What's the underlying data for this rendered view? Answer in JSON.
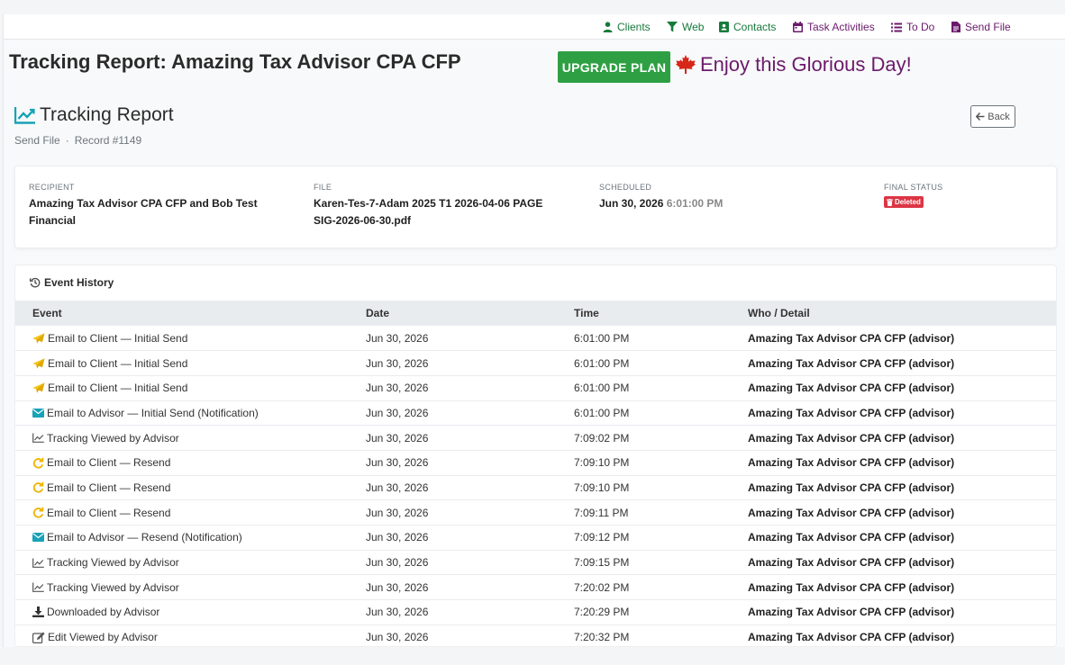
{
  "nav": {
    "items": [
      {
        "label": "Clients",
        "icon": "user-icon"
      },
      {
        "label": "Web",
        "icon": "filter-icon"
      },
      {
        "label": "Contacts",
        "icon": "address-book-icon"
      },
      {
        "label": "Task Activities",
        "icon": "calendar-icon"
      },
      {
        "label": "To Do",
        "icon": "list-icon"
      },
      {
        "label": "Send File",
        "icon": "file-icon"
      }
    ]
  },
  "header": {
    "title": "Tracking Report: Amazing Tax Advisor CPA CFP",
    "upgrade_label": "UPGRADE PLAN",
    "tagline": "Enjoy this Glorious Day!"
  },
  "report": {
    "title": "Tracking Report",
    "crumb_section": "Send File",
    "crumb_separator": "·",
    "crumb_record": "Record #1149",
    "back_label": "Back"
  },
  "summary": {
    "recipient_label": "Recipient",
    "recipient_line1": "Amazing Tax Advisor CPA CFP and Bob Test",
    "recipient_line2": "Financial",
    "file_label": "File",
    "file_line1": "Karen-Tes-7-Adam 2025 T1 2026-04-06 PAGE",
    "file_line2": "SIG-2026-06-30.pdf",
    "scheduled_label": "Scheduled",
    "scheduled_date": "Jun 30, 2026",
    "scheduled_time": "6:01:00 PM",
    "final_status_label": "Final Status",
    "final_status": "Deleted"
  },
  "history": {
    "title": "Event History",
    "columns": [
      "Event",
      "Date",
      "Time",
      "Who / Detail"
    ],
    "rows": [
      {
        "icon": "paper-plane-icon",
        "event": "Email to Client — Initial Send",
        "date": "Jun 30, 2026",
        "time": "6:01:00 PM",
        "who": "Amazing Tax Advisor CPA CFP (advisor)"
      },
      {
        "icon": "paper-plane-icon",
        "event": "Email to Client — Initial Send",
        "date": "Jun 30, 2026",
        "time": "6:01:00 PM",
        "who": "Amazing Tax Advisor CPA CFP (advisor)"
      },
      {
        "icon": "paper-plane-icon",
        "event": "Email to Client — Initial Send",
        "date": "Jun 30, 2026",
        "time": "6:01:00 PM",
        "who": "Amazing Tax Advisor CPA CFP (advisor)"
      },
      {
        "icon": "envelope-icon",
        "event": "Email to Advisor — Initial Send (Notification)",
        "date": "Jun 30, 2026",
        "time": "6:01:00 PM",
        "who": "Amazing Tax Advisor CPA CFP (advisor)"
      },
      {
        "icon": "chart-line-icon",
        "event": "Tracking Viewed by Advisor",
        "date": "Jun 30, 2026",
        "time": "7:09:02 PM",
        "who": "Amazing Tax Advisor CPA CFP (advisor)"
      },
      {
        "icon": "redo-icon",
        "event": "Email to Client — Resend",
        "date": "Jun 30, 2026",
        "time": "7:09:10 PM",
        "who": "Amazing Tax Advisor CPA CFP (advisor)"
      },
      {
        "icon": "redo-icon",
        "event": "Email to Client — Resend",
        "date": "Jun 30, 2026",
        "time": "7:09:10 PM",
        "who": "Amazing Tax Advisor CPA CFP (advisor)"
      },
      {
        "icon": "redo-icon",
        "event": "Email to Client — Resend",
        "date": "Jun 30, 2026",
        "time": "7:09:11 PM",
        "who": "Amazing Tax Advisor CPA CFP (advisor)"
      },
      {
        "icon": "envelope-icon",
        "event": "Email to Advisor — Resend (Notification)",
        "date": "Jun 30, 2026",
        "time": "7:09:12 PM",
        "who": "Amazing Tax Advisor CPA CFP (advisor)"
      },
      {
        "icon": "chart-line-icon",
        "event": "Tracking Viewed by Advisor",
        "date": "Jun 30, 2026",
        "time": "7:09:15 PM",
        "who": "Amazing Tax Advisor CPA CFP (advisor)"
      },
      {
        "icon": "chart-line-icon",
        "event": "Tracking Viewed by Advisor",
        "date": "Jun 30, 2026",
        "time": "7:20:02 PM",
        "who": "Amazing Tax Advisor CPA CFP (advisor)"
      },
      {
        "icon": "download-icon",
        "event": "Downloaded by Advisor",
        "date": "Jun 30, 2026",
        "time": "7:20:29 PM",
        "who": "Amazing Tax Advisor CPA CFP (advisor)"
      },
      {
        "icon": "edit-icon",
        "event": "Edit Viewed by Advisor",
        "date": "Jun 30, 2026",
        "time": "7:20:32 PM",
        "who": "Amazing Tax Advisor CPA CFP (advisor)"
      }
    ]
  },
  "colors": {
    "nav_text": "#6b1a6b",
    "nav_active": "#167a3a",
    "upgrade_bg": "#2ea043",
    "tagline": "#6b1a6b",
    "deleted_badge": "#dc3545",
    "chart_icon": "#17a2b8"
  }
}
